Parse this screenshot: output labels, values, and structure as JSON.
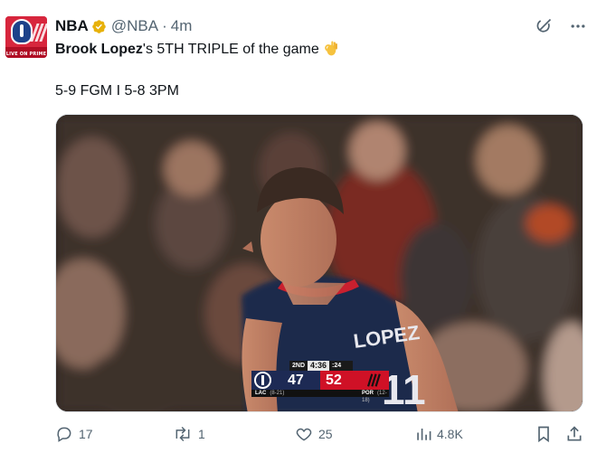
{
  "author": {
    "name": "NBA",
    "handle": "@NBA",
    "separator": "·",
    "time": "4m",
    "avatar_tag": "LIVE ON PRIME"
  },
  "tweet": {
    "player_name": "Brook Lopez",
    "text_rest": "'s 5TH TRIPLE of the game",
    "emoji": "ok-hand-emoji",
    "stats_line": "5-9 FGM I 5-8 3PM"
  },
  "scoreboard": {
    "quarter": "2ND",
    "clock": "4:36",
    "shot_clock": ":24",
    "home_abbr": "LAC",
    "home_record": "(8-21)",
    "home_score": "47",
    "away_abbr": "POR",
    "away_record": "(12-18)",
    "away_score": "52"
  },
  "jersey_text": "LOPEZ",
  "actions": {
    "replies": "17",
    "reposts": "1",
    "likes": "25",
    "views": "4.8K"
  },
  "colors": {
    "verified": "#e7b10a",
    "text_secondary": "#536471",
    "lac_navy": "#1d2a54",
    "por_red": "#cf1126"
  },
  "icons": [
    "grok-icon",
    "more-icon",
    "reply-icon",
    "repost-icon",
    "like-icon",
    "views-icon",
    "bookmark-icon",
    "share-icon"
  ]
}
